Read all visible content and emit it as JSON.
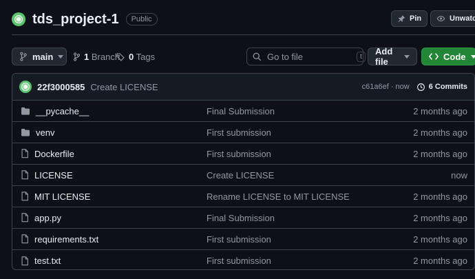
{
  "repo": {
    "name": "tds_project-1",
    "visibility": "Public",
    "pin_label": "Pin",
    "watch_label": "Unwatch"
  },
  "toolbar": {
    "branch": "main",
    "branch_count": "1",
    "branch_word": "Branch",
    "tag_count": "0",
    "tag_word": "Tags",
    "search_placeholder": "Go to file",
    "search_shortcut": "t",
    "add_file_label": "Add file",
    "code_label": "Code"
  },
  "latest_commit": {
    "author": "22f3000585",
    "message": "Create LICENSE",
    "hash_time": "c61a6ef · now",
    "commit_count_label": "6 Commits"
  },
  "files": [
    {
      "name": "__pycache__",
      "type": "folder",
      "message": "Final Submission",
      "age": "2 months ago"
    },
    {
      "name": "venv",
      "type": "folder",
      "message": "First submission",
      "age": "2 months ago"
    },
    {
      "name": "Dockerfile",
      "type": "file",
      "message": "First submission",
      "age": "2 months ago"
    },
    {
      "name": "LICENSE",
      "type": "file",
      "message": "Create LICENSE",
      "age": "now"
    },
    {
      "name": "MIT LICENSE",
      "type": "file",
      "message": "Rename LICENSE to MIT LICENSE",
      "age": "2 months ago"
    },
    {
      "name": "app.py",
      "type": "file",
      "message": "Final Submission",
      "age": "2 months ago"
    },
    {
      "name": "requirements.txt",
      "type": "file",
      "message": "First submission",
      "age": "2 months ago"
    },
    {
      "name": "test.txt",
      "type": "file",
      "message": "First submission",
      "age": "2 months ago"
    }
  ]
}
